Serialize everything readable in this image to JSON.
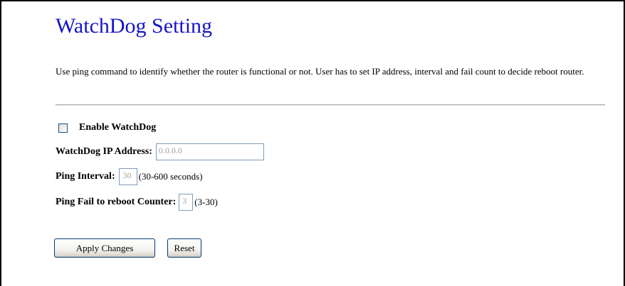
{
  "page": {
    "title": "WatchDog Setting",
    "description": "Use ping command to identify whether the router is functional or not. User has to set IP address, interval and fail count to decide reboot router."
  },
  "form": {
    "enable": {
      "label": "Enable WatchDog",
      "checked": false
    },
    "ip_address": {
      "label": "WatchDog IP Address:",
      "value": "0.0.0.0"
    },
    "ping_interval": {
      "label": "Ping Interval:",
      "value": "30",
      "hint": "(30-600 seconds)"
    },
    "fail_counter": {
      "label": "Ping Fail to reboot Counter:",
      "value": "3",
      "hint": "(3-30)"
    }
  },
  "buttons": {
    "apply": "Apply Changes",
    "reset": "Reset"
  },
  "colors": {
    "title": "#1515c8",
    "divider": "#a8a8a8",
    "input_border": "#7f9db9",
    "disabled_text": "#a0a0a0"
  }
}
